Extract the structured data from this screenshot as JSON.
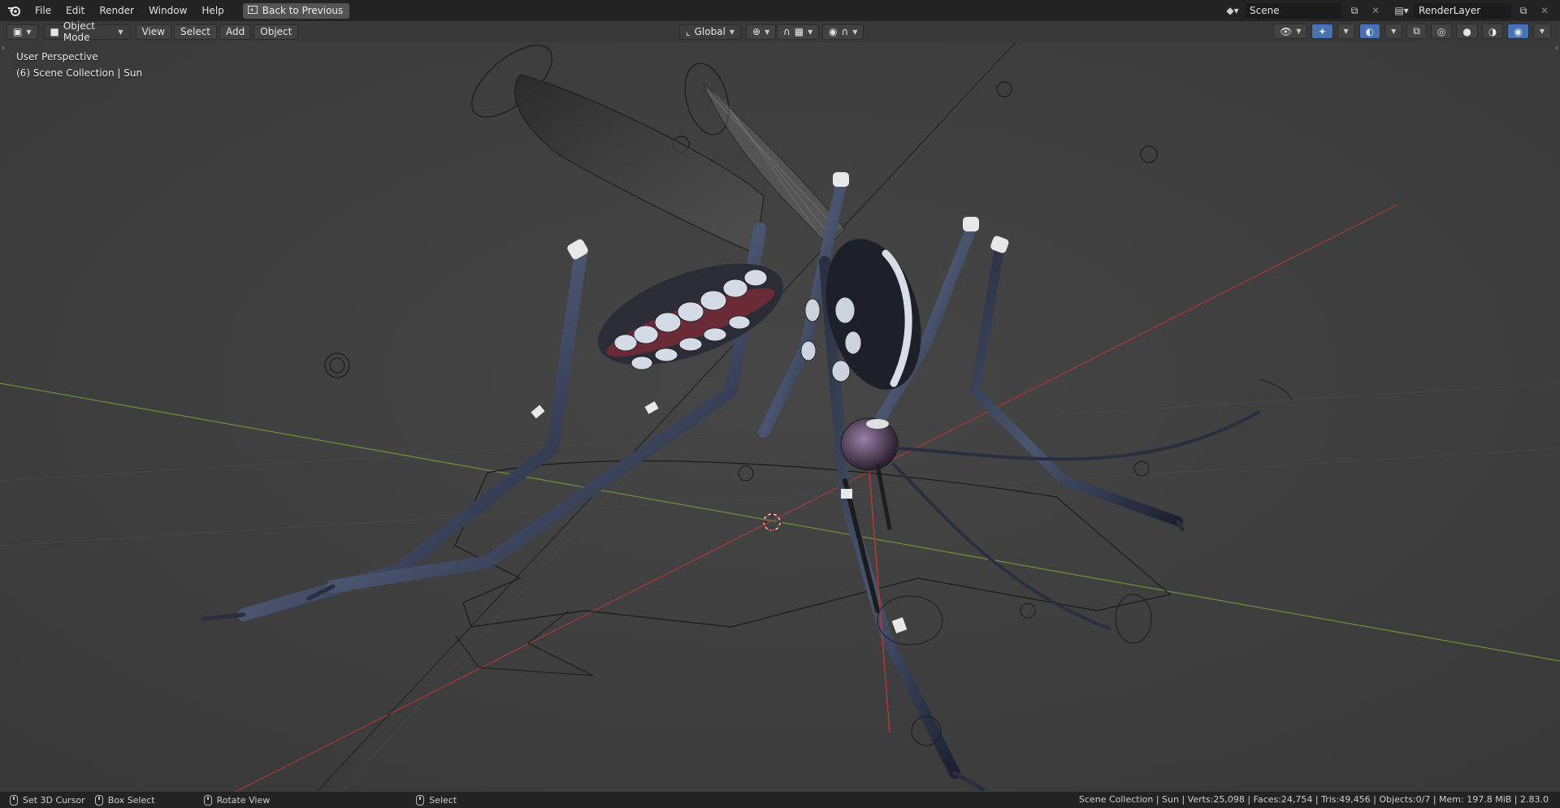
{
  "menu": {
    "items": [
      "File",
      "Edit",
      "Render",
      "Window",
      "Help"
    ],
    "back_button": "Back to Previous"
  },
  "top_right": {
    "scene_name": "Scene",
    "layer_name": "RenderLayer"
  },
  "header": {
    "mode": "Object Mode",
    "menus": [
      "View",
      "Select",
      "Add",
      "Object"
    ],
    "orientation": "Global"
  },
  "viewport": {
    "perspective": "User Perspective",
    "collection": "(6) Scene Collection | Sun"
  },
  "status": {
    "left_items": [
      "Set 3D Cursor",
      "Box Select",
      "Rotate View",
      "Select"
    ],
    "stats": "Scene Collection | Sun | Verts:25,098 | Faces:24,754 | Tris:49,456 | Objects:0/7 | Mem: 197.8 MiB | 2.83.0"
  },
  "colors": {
    "accent": "#4772b3",
    "x_axis": "#b03a3a",
    "y_axis": "#7da33d"
  }
}
